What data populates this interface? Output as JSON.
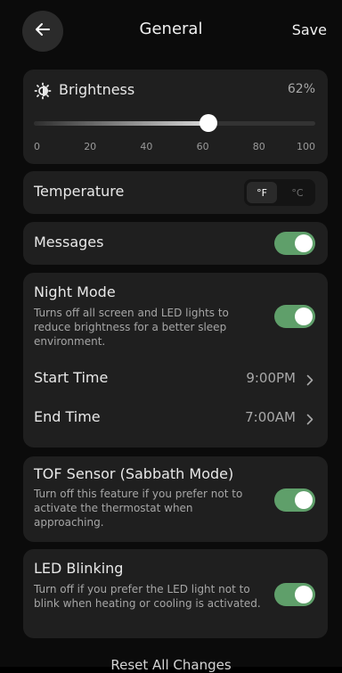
{
  "header": {
    "title": "General",
    "save_label": "Save"
  },
  "brightness": {
    "label": "Brightness",
    "value_label": "62%",
    "value": 0.62,
    "slider_ticks": [
      "0",
      "20",
      "40",
      "60",
      "80",
      "100"
    ]
  },
  "temperature": {
    "label": "Temperature",
    "unit_f": "°F",
    "unit_c": "°C",
    "selected": "°F"
  },
  "messages": {
    "label": "Messages",
    "enabled": true
  },
  "night_mode": {
    "title": "Night Mode",
    "description": "Turns off all screen and LED lights to reduce brightness for a better sleep environment.",
    "enabled": true,
    "start_time_label": "Start Time",
    "start_time_value": "9:00PM",
    "end_time_label": "End Time",
    "end_time_value": "7:00AM"
  },
  "tof_sensor": {
    "title": "TOF Sensor (Sabbath Mode)",
    "description": "Turn off this feature if you prefer not to activate the thermostat when approaching.",
    "enabled": true
  },
  "led_blinking": {
    "title": "LED Blinking",
    "description": "Turn off if you prefer the LED light not to blink when heating or cooling is activated.",
    "enabled": true
  },
  "footer": {
    "reset_label": "Reset All Changes"
  },
  "colors": {
    "toggle_on": "#5f9f6a",
    "card_bg": "#1f1f1f",
    "page_bg": "#0b0b0b"
  }
}
